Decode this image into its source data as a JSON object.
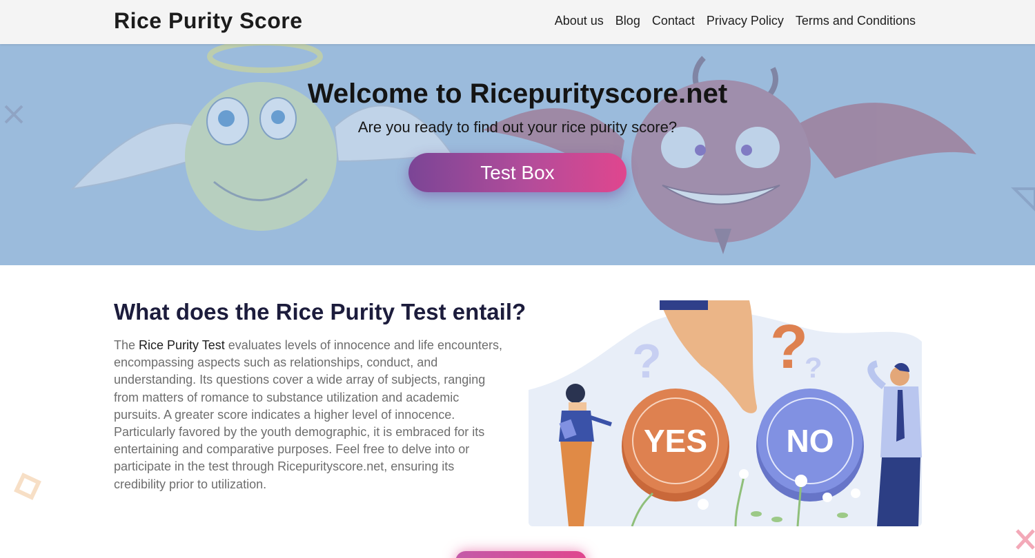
{
  "header": {
    "brand": "Rice Purity Score",
    "nav": [
      "About us",
      "Blog",
      "Contact",
      "Privacy Policy",
      "Terms and Conditions"
    ]
  },
  "hero": {
    "title": "Welcome to Ricepurityscore.net",
    "subtitle": "Are you ready to find out your rice purity score?",
    "cta_label": "Test Box"
  },
  "content": {
    "heading": "What does the Rice Purity Test entail?",
    "para_prefix": "The ",
    "para_link": "Rice Purity Test",
    "para_body": " evaluates levels of innocence and life encounters, encompassing aspects such as relationships, conduct, and understanding. Its questions cover a wide array of subjects, ranging from matters of romance to substance utilization and academic pursuits. A greater score indicates a higher level of innocence. Particularly favored by the youth demographic, it is embraced for its entertaining and comparative purposes. Feel free to delve into or participate in the test through Ricepurityscore.net, ensuring its credibility prior to utilization.",
    "illustration": {
      "yes_label": "YES",
      "no_label": "NO"
    }
  },
  "colors": {
    "hero_bg": "#9bbbdc",
    "cta_gradient_start": "#7b4596",
    "cta_gradient_end": "#e0468e",
    "yes_coin": "#de8150",
    "no_coin": "#8191e2"
  },
  "icons": [
    "angel-emoji-icon",
    "devil-emoji-icon",
    "yes-coin-icon",
    "no-coin-icon",
    "question-mark-icon"
  ]
}
